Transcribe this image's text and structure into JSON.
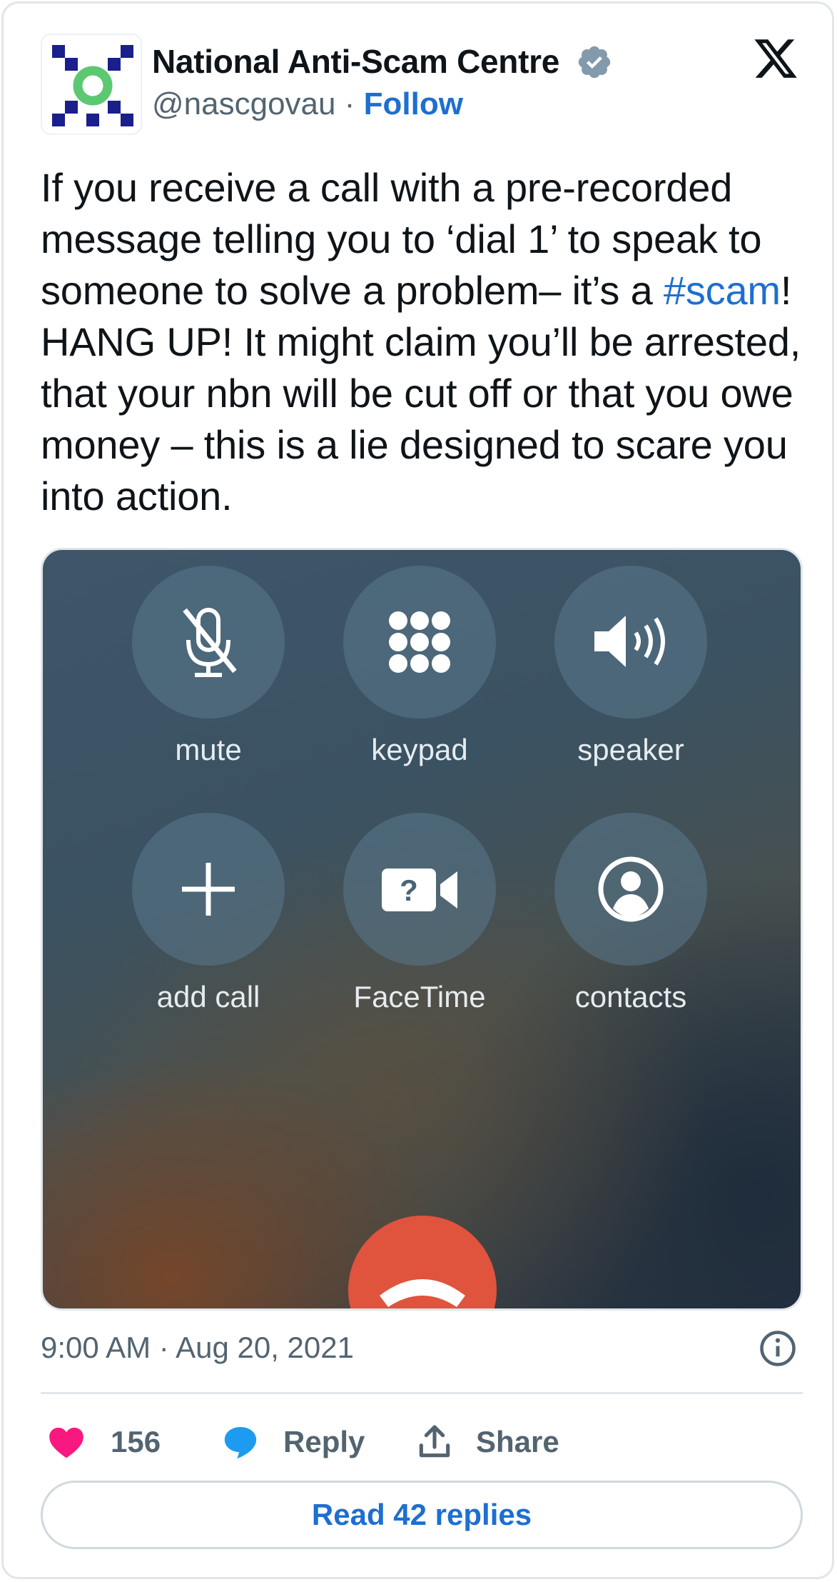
{
  "author": {
    "display_name": "National Anti-Scam Centre",
    "handle": "@nascgovau",
    "separator": " · ",
    "follow_label": "Follow"
  },
  "tweet": {
    "text_part1": "If you receive a call with a pre-recorded message telling you to ‘dial 1’ to speak to someone to solve a problem– it’s a ",
    "hashtag": "#scam",
    "text_part2": "! HANG UP! It might claim you’ll be arrested, that your nbn will be cut off or that you owe money – this is a lie designed to scare you into action."
  },
  "media": {
    "call_buttons": [
      {
        "label": "mute",
        "icon": "mic-off-icon"
      },
      {
        "label": "keypad",
        "icon": "keypad-icon"
      },
      {
        "label": "speaker",
        "icon": "speaker-icon"
      },
      {
        "label": "add call",
        "icon": "plus-icon"
      },
      {
        "label": "FaceTime",
        "icon": "facetime-icon"
      },
      {
        "label": "contacts",
        "icon": "contact-icon"
      }
    ],
    "end_call_color": "#e0533d"
  },
  "meta": {
    "timestamp": "9:00 AM · Aug 20, 2021"
  },
  "actions": {
    "likes_count": "156",
    "reply_label": "Reply",
    "share_label": "Share",
    "read_replies_label": "Read 42 replies"
  },
  "colors": {
    "accent": "#1d6fd1",
    "like": "#f91880",
    "reply_icon": "#1d9bf0",
    "verified": "#829aab"
  }
}
